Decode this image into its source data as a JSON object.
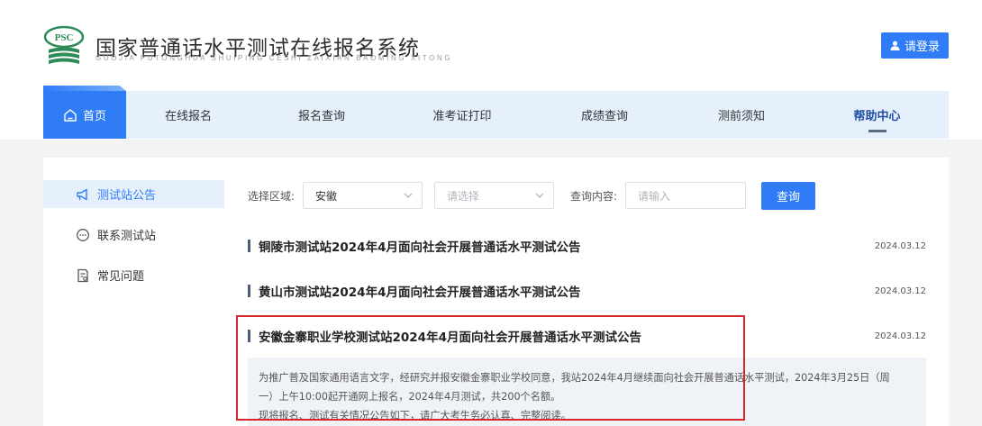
{
  "header": {
    "logo_text": "PSC",
    "title": "国家普通话水平测试在线报名系统",
    "subtitle": "GUOJIA PUTONGHUA SHUIPING CESHI ZAIXIAN BAOMING XITONG",
    "login_label": "请登录",
    "accent_color": "#2f7cf6"
  },
  "nav": {
    "items": [
      {
        "label": "首页",
        "icon": "home-icon"
      },
      {
        "label": "在线报名"
      },
      {
        "label": "报名查询"
      },
      {
        "label": "准考证打印"
      },
      {
        "label": "成绩查询"
      },
      {
        "label": "测前须知"
      },
      {
        "label": "帮助中心"
      }
    ]
  },
  "sidebar": {
    "items": [
      {
        "label": "测试站公告",
        "icon": "megaphone-icon"
      },
      {
        "label": "联系测试站",
        "icon": "chat-icon"
      },
      {
        "label": "常见问题",
        "icon": "document-icon"
      }
    ]
  },
  "filters": {
    "region_label": "选择区域:",
    "province_value": "安徽",
    "city_placeholder": "请选择",
    "query_label": "查询内容:",
    "query_placeholder": "请输入",
    "query_button": "查询"
  },
  "notices": [
    {
      "title": "铜陵市测试站2024年4月面向社会开展普通话水平测试公告",
      "date": "2024.03.12"
    },
    {
      "title": "黄山市测试站2024年4月面向社会开展普通话水平测试公告",
      "date": "2024.03.12"
    },
    {
      "title": "安徽金寨职业学校测试站2024年4月面向社会开展普通话水平测试公告",
      "date": "2024.03.12"
    }
  ],
  "detail": {
    "line1": "为推广普及国家通用语言文字，经研究并报安徽金寨职业学校同意，我站2024年4月继续面向社会开展普通话水平测试，2024年3月25日（周",
    "line2": "一）上午10:00起开通网上报名，2024年4月测试，共200个名额。",
    "line3": "现将报名、测试有关情况公告如下，请广大考生务必认真、完整阅读。"
  }
}
